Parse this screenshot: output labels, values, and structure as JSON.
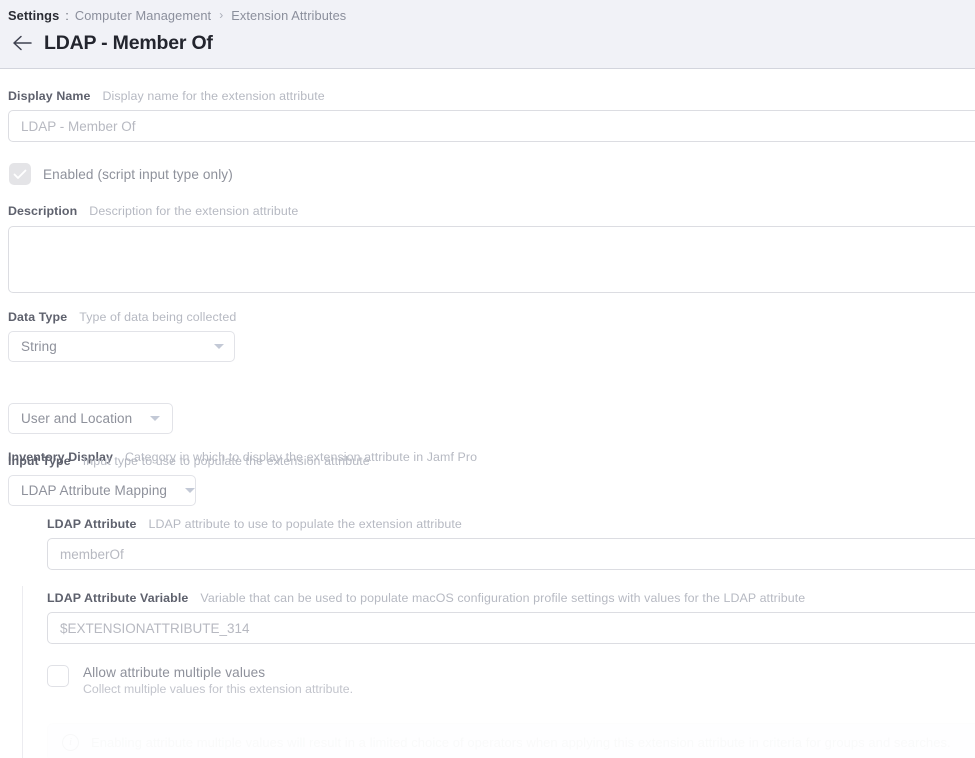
{
  "header": {
    "breadcrumb": {
      "root": "Settings",
      "colon": ":",
      "parent": "Computer Management",
      "separator": "›",
      "current": "Extension Attributes"
    },
    "back_icon": "arrow-left-icon",
    "title": "LDAP - Member Of"
  },
  "form": {
    "display_name": {
      "label": "Display Name",
      "help": "Display name for the extension attribute",
      "placeholder": "LDAP - Member Of",
      "value": ""
    },
    "enabled": {
      "label": "Enabled (script input type only)",
      "checked": true,
      "disabled": true
    },
    "description": {
      "label": "Description",
      "help": "Description for the extension attribute",
      "placeholder": "",
      "value": ""
    },
    "data_type": {
      "label": "Data Type",
      "help": "Type of data being collected",
      "selected": "String"
    },
    "inventory_display": {
      "label": "Inventory Display",
      "help": "Category in which to display the extension attribute in Jamf Pro",
      "selected": "User and Location"
    },
    "input_type": {
      "label": "Input Type",
      "help": "Input type to use to populate the extension attribute",
      "selected": "LDAP Attribute Mapping"
    },
    "ldap_attribute": {
      "label": "LDAP Attribute",
      "help": "LDAP attribute to use to populate the extension attribute",
      "placeholder": "memberOf",
      "value": ""
    },
    "ldap_attribute_variable": {
      "label": "LDAP Attribute Variable",
      "help": "Variable that can be used to populate macOS configuration profile settings with values for the LDAP attribute",
      "placeholder": "$EXTENSIONATTRIBUTE_314",
      "value": ""
    },
    "allow_multiple": {
      "label": "Allow attribute multiple values",
      "sublabel": "Collect multiple values for this extension attribute.",
      "checked": false
    },
    "multiple_values_notice": {
      "icon": "info-icon",
      "text": "Enabling attribute multiple values will result in a limited choice of operators when applying this extension attribute in criteria for groups and searches."
    }
  }
}
